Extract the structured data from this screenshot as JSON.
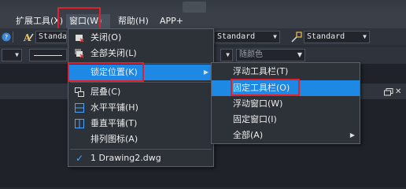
{
  "menubar": {
    "items": [
      "扩展工具(X)",
      "窗口(W)",
      "帮助(H)",
      "APP+"
    ]
  },
  "toolbar1": {
    "textstyle_value": "Standard",
    "dimstyle_value": "Standard",
    "mlstyle_value": "Standard"
  },
  "toolbar2": {
    "color_value": "随颜色"
  },
  "window_menu": {
    "items": [
      {
        "label": "关闭(O)",
        "icon": "close-window-icon"
      },
      {
        "label": "全部关闭(L)",
        "icon": "close-all-icon"
      },
      {
        "label": "锁定位置(K)",
        "icon": "",
        "has_submenu": true
      },
      {
        "label": "层叠(C)",
        "icon": "cascade-icon"
      },
      {
        "label": "水平平铺(H)",
        "icon": "tile-horizontal-icon"
      },
      {
        "label": "垂直平铺(T)",
        "icon": "tile-vertical-icon"
      },
      {
        "label": "排列图标(A)",
        "icon": ""
      },
      {
        "label": "1 Drawing2.dwg",
        "icon": "check-icon"
      }
    ]
  },
  "lock_submenu": {
    "items": [
      {
        "label": "浮动工具栏(T)"
      },
      {
        "label": "固定工具栏(O)"
      },
      {
        "label": "浮动窗口(W)"
      },
      {
        "label": "固定窗口(I)"
      },
      {
        "label": "全部(A)",
        "has_submenu": true
      }
    ]
  },
  "colors": {
    "highlight": "#1e88e5",
    "annotation_red": "#e0202a",
    "menu_bg": "#2d3138"
  }
}
